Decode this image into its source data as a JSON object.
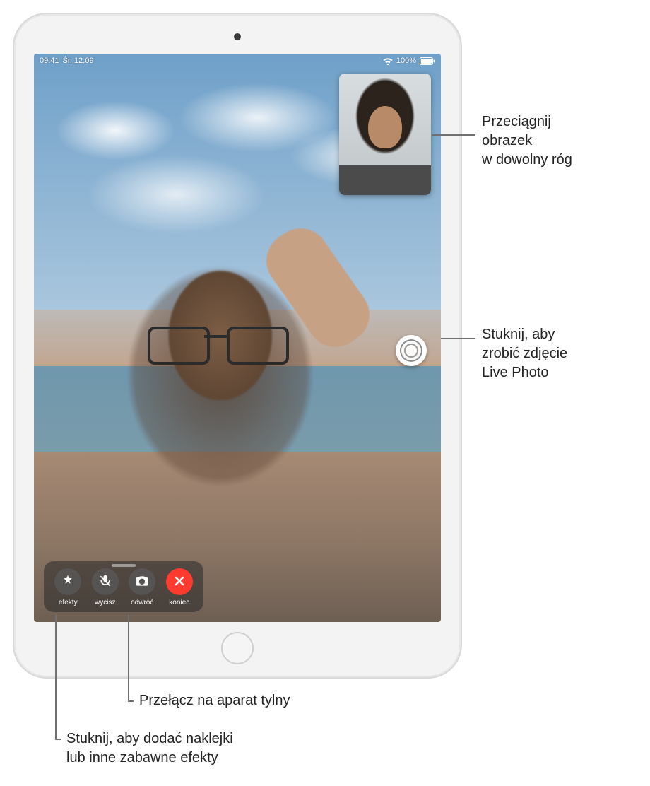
{
  "statusbar": {
    "time": "09:41",
    "date": "Śr. 12.09",
    "battery_pct": "100%"
  },
  "controls": {
    "effects": "efekty",
    "mute": "wycisz",
    "flip": "odwróć",
    "end": "koniec"
  },
  "callouts": {
    "pip": "Przeciągnij\nobrazek\nw dowolny róg",
    "live_photo": "Stuknij, aby\nzrobić zdjęcie\nLive Photo",
    "flip": "Przełącz na aparat tylny",
    "effects": "Stuknij, aby dodać naklejki\nlub inne zabawne efekty"
  }
}
